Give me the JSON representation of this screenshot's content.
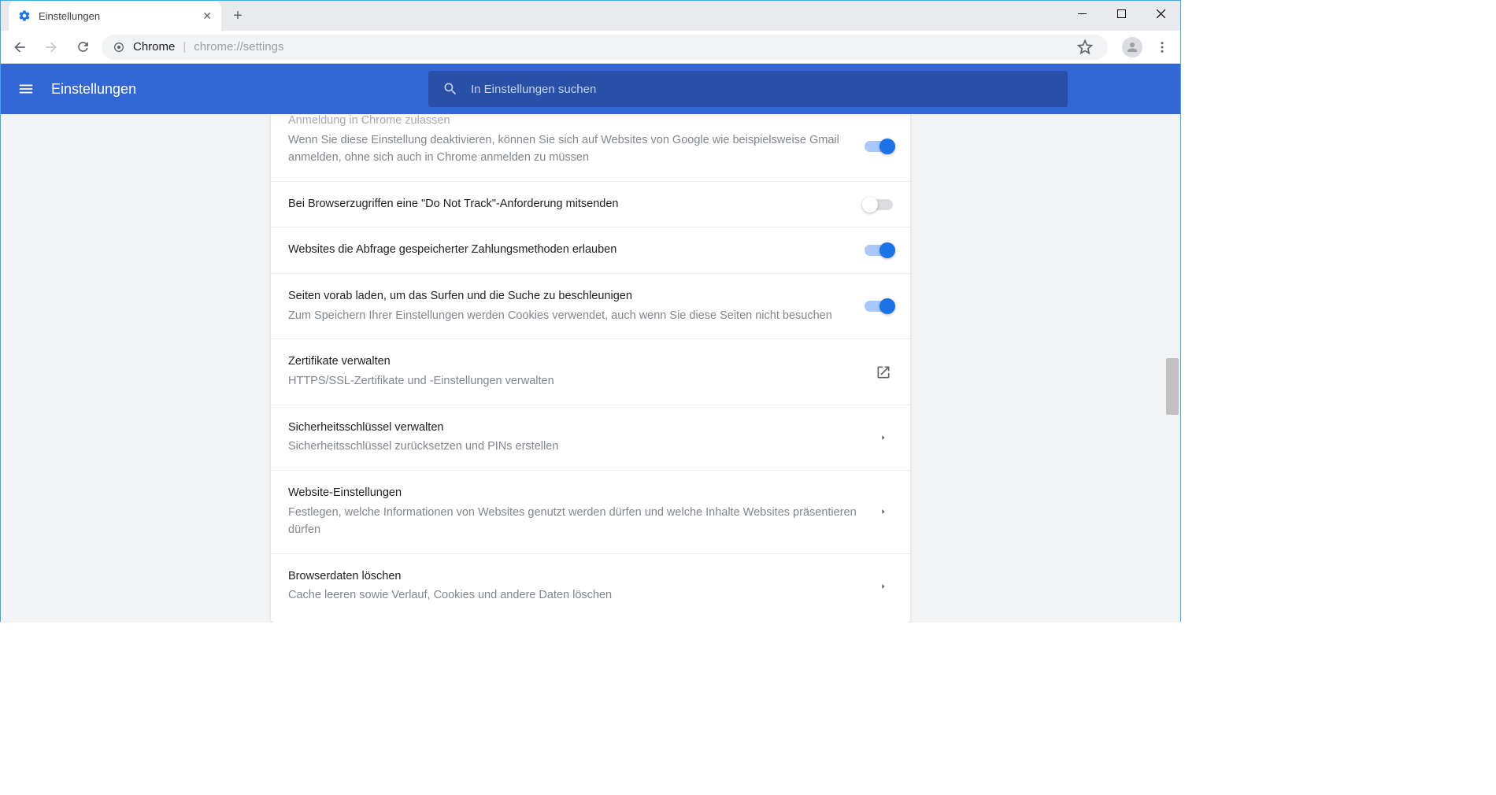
{
  "window": {
    "tab_title": "Einstellungen"
  },
  "address": {
    "site_label": "Chrome",
    "url": "chrome://settings"
  },
  "header": {
    "title": "Einstellungen",
    "search_placeholder": "In Einstellungen suchen"
  },
  "rows": {
    "allow_signin": {
      "title": "Anmeldung in Chrome zulassen",
      "sub": "Wenn Sie diese Einstellung deaktivieren, können Sie sich auf Websites von Google wie beispielsweise Gmail anmelden, ohne sich auch in Chrome anmelden zu müssen",
      "on": true
    },
    "dnt": {
      "title": "Bei Browserzugriffen eine \"Do Not Track\"-Anforderung mitsenden",
      "on": false
    },
    "payment": {
      "title": "Websites die Abfrage gespeicherter Zahlungsmethoden erlauben",
      "on": true
    },
    "preload": {
      "title": "Seiten vorab laden, um das Surfen und die Suche zu beschleunigen",
      "sub": "Zum Speichern Ihrer Einstellungen werden Cookies verwendet, auch wenn Sie diese Seiten nicht besuchen",
      "on": true
    },
    "certs": {
      "title": "Zertifikate verwalten",
      "sub": "HTTPS/SSL-Zertifikate und -Einstellungen verwalten"
    },
    "seckeys": {
      "title": "Sicherheitsschlüssel verwalten",
      "sub": "Sicherheitsschlüssel zurücksetzen und PINs erstellen"
    },
    "site": {
      "title": "Website-Einstellungen",
      "sub": "Festlegen, welche Informationen von Websites genutzt werden dürfen und welche Inhalte Websites präsentieren dürfen"
    },
    "clear": {
      "title": "Browserdaten löschen",
      "sub": "Cache leeren sowie Verlauf, Cookies und andere Daten löschen"
    }
  }
}
